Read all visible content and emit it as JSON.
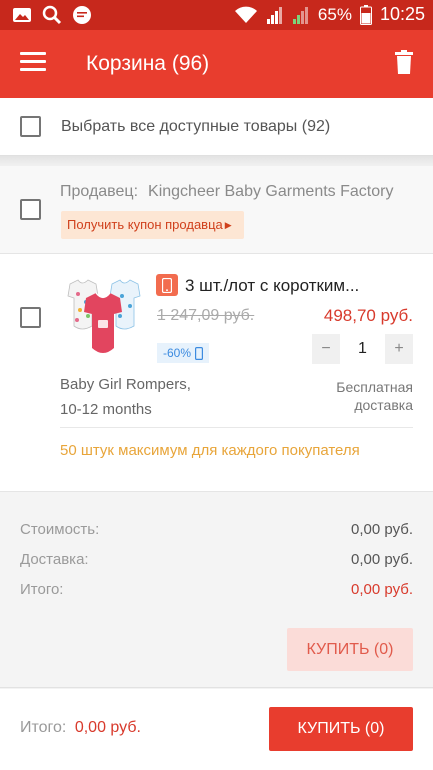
{
  "status_bar": {
    "battery": "65%",
    "time": "10:25",
    "left_icons": [
      "image-icon",
      "search-icon",
      "chat-icon"
    ],
    "right_icons": [
      "wifi-icon",
      "signal-1-icon",
      "signal-2-icon",
      "battery-icon"
    ]
  },
  "app_bar": {
    "title": "Корзина (96)"
  },
  "select_all": {
    "label": "Выбрать все доступные товары (92)"
  },
  "seller": {
    "prefix": "Продавец:",
    "name": "Kingcheer Baby Garments Factory",
    "coupon_label": "Получить купон продавца"
  },
  "product": {
    "title": "3 шт./лот с коротким...",
    "old_price": "1 247,09 руб.",
    "new_price": "498,70 руб.",
    "discount": "-60%",
    "quantity": "1",
    "minus_label": "−",
    "plus_label": "+",
    "variant_line1": "Baby Girl Rompers,",
    "variant_line2": "10-12 months",
    "shipping_line1": "Бесплатная",
    "shipping_line2": "доставка",
    "max_note": "50 штук максимум для каждого покупателя"
  },
  "summary": {
    "cost_label": "Стоимость:",
    "cost_value": "0,00 руб.",
    "delivery_label": "Доставка:",
    "delivery_value": "0,00 руб.",
    "total_label": "Итого:",
    "total_value": "0,00 руб.",
    "buy_label": "КУПИТЬ (0)"
  },
  "bottom_bar": {
    "total_label": "Итого:",
    "total_value": "0,00 руб.",
    "buy_label": "КУПИТЬ (0)"
  },
  "colors": {
    "accent": "#e83d2e",
    "status_bar": "#c7281c",
    "price_red": "#d83a2c",
    "note_orange": "#e8a53a",
    "discount_blue": "#3c8be0"
  }
}
